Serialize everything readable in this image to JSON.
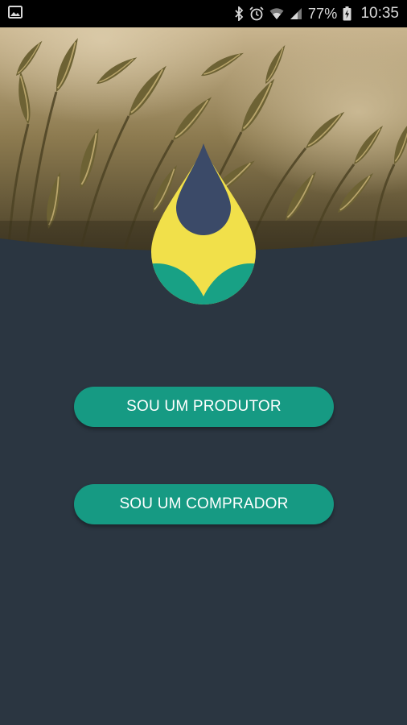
{
  "status_bar": {
    "battery_percent": "77%",
    "time": "10:35",
    "icons": [
      "image-icon",
      "bluetooth-icon",
      "alarm-icon",
      "wifi-icon",
      "signal-icon",
      "battery-charging-icon"
    ]
  },
  "hero": {
    "image": "wheat-field-photo"
  },
  "logo": {
    "name": "drop-logo",
    "colors": {
      "drop": "#3b4a68",
      "yellow": "#f1e04a",
      "green": "#18a185"
    }
  },
  "actions": {
    "produtor_label": "SOU UM PRODUTOR",
    "comprador_label": "SOU UM COMPRADOR"
  },
  "colors": {
    "background": "#2b3641",
    "button": "#169a83",
    "button_text": "#ffffff"
  }
}
